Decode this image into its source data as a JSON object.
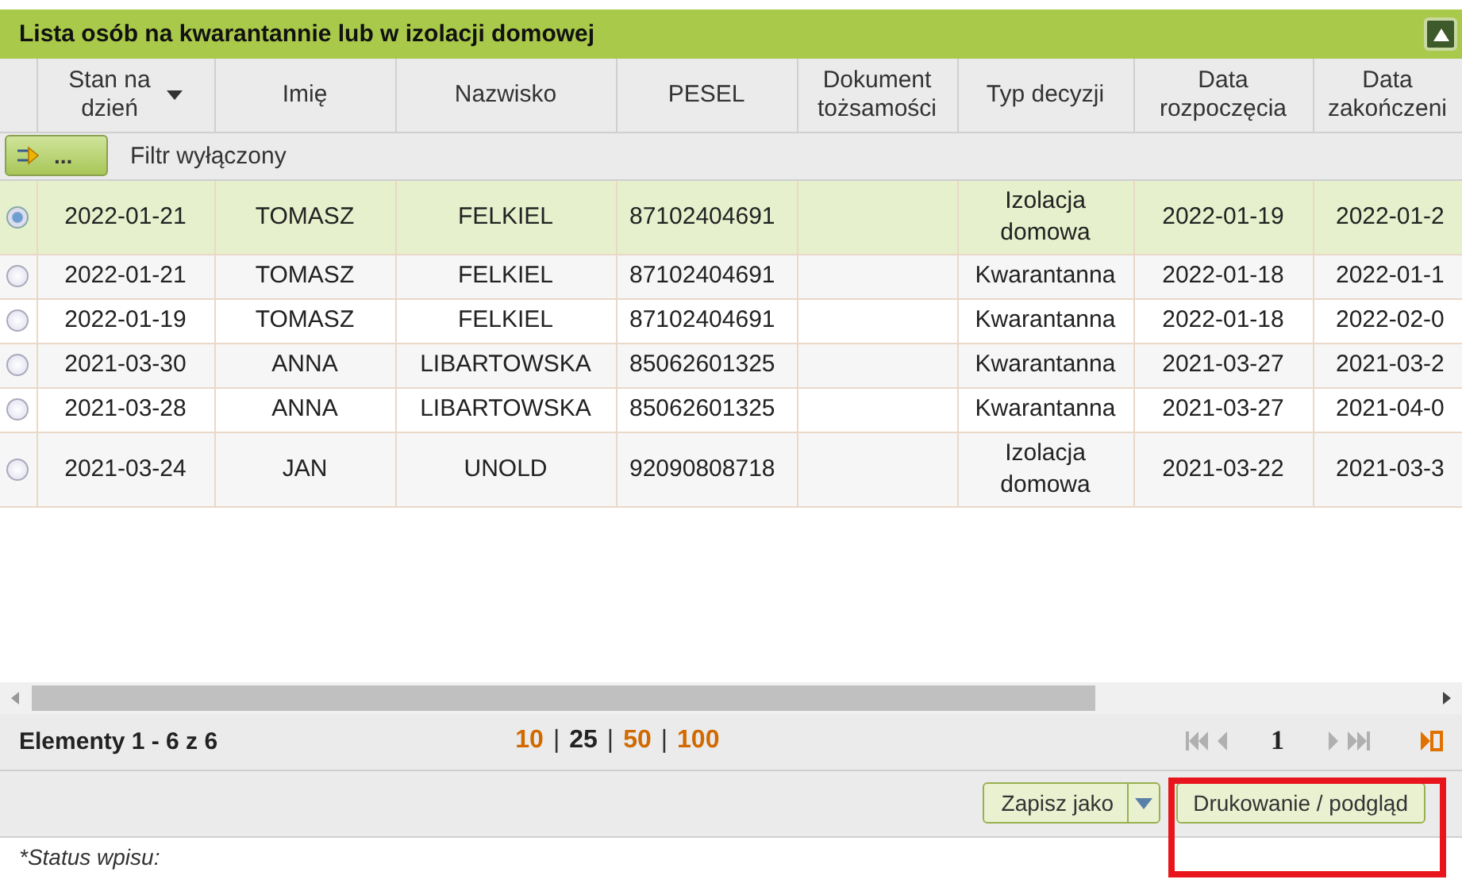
{
  "panel": {
    "title": "Lista osób na kwarantannie lub w izolacji domowej",
    "collapsed": false
  },
  "table": {
    "columns": [
      {
        "label": "Stan na\ndzień",
        "sorted": true
      },
      {
        "label": "Imię",
        "sorted": false
      },
      {
        "label": "Nazwisko",
        "sorted": false
      },
      {
        "label": "PESEL",
        "sorted": false
      },
      {
        "label": "Dokument\ntożsamości",
        "sorted": false
      },
      {
        "label": "Typ decyzji",
        "sorted": false
      },
      {
        "label": "Data\nrozpoczęcia",
        "sorted": false
      },
      {
        "label": "Data\nzakończeni",
        "sorted": false
      }
    ],
    "filter": {
      "button": "...",
      "label": "Filtr wyłączony"
    },
    "rows": [
      {
        "selected": true,
        "cells": [
          "2022-01-21",
          "TOMASZ",
          "FELKIEL",
          "87102404691",
          "",
          "Izolacja\ndomowa",
          "2022-01-19",
          "2022-01-2"
        ]
      },
      {
        "selected": false,
        "cells": [
          "2022-01-21",
          "TOMASZ",
          "FELKIEL",
          "87102404691",
          "",
          "Kwarantanna",
          "2022-01-18",
          "2022-01-1"
        ]
      },
      {
        "selected": false,
        "cells": [
          "2022-01-19",
          "TOMASZ",
          "FELKIEL",
          "87102404691",
          "",
          "Kwarantanna",
          "2022-01-18",
          "2022-02-0"
        ]
      },
      {
        "selected": false,
        "cells": [
          "2021-03-30",
          "ANNA",
          "LIBARTOWSKA",
          "85062601325",
          "",
          "Kwarantanna",
          "2021-03-27",
          "2021-03-2"
        ]
      },
      {
        "selected": false,
        "cells": [
          "2021-03-28",
          "ANNA",
          "LIBARTOWSKA",
          "85062601325",
          "",
          "Kwarantanna",
          "2021-03-27",
          "2021-04-0"
        ]
      },
      {
        "selected": false,
        "cells": [
          "2021-03-24",
          "JAN",
          "UNOLD",
          "92090808718",
          "",
          "Izolacja\ndomowa",
          "2021-03-22",
          "2021-03-3"
        ]
      }
    ]
  },
  "pager": {
    "summary": "Elementy 1 - 6 z 6",
    "separator": "|",
    "page_sizes": [
      {
        "label": "10",
        "selected": false
      },
      {
        "label": "25",
        "selected": true
      },
      {
        "label": "50",
        "selected": false
      },
      {
        "label": "100",
        "selected": false
      }
    ],
    "page": "1"
  },
  "actions": [
    {
      "label": "Zapisz jako",
      "kind": "split"
    },
    {
      "label": "Drukowanie / podgląd",
      "kind": "plain"
    }
  ],
  "footnote": "*Status wpisu:"
}
